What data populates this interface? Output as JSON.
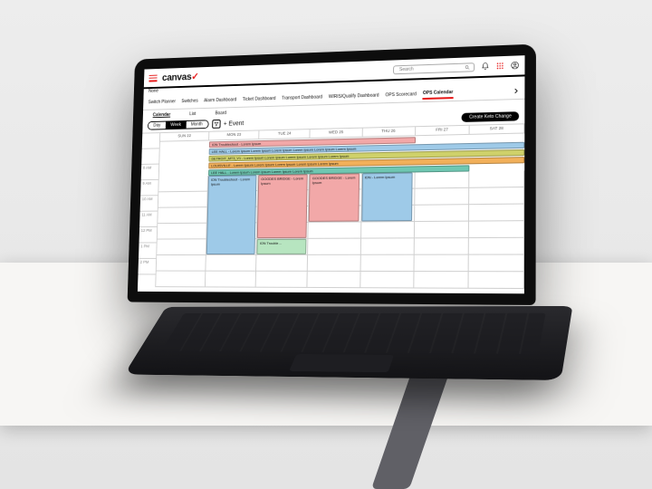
{
  "brand": {
    "name": "canvas",
    "accent": "✓",
    "subtitle": "None"
  },
  "search": {
    "placeholder": "Search"
  },
  "nav_tabs": [
    "Switch Planner",
    "Switches",
    "Alarm Dashboard",
    "Ticket Dashboard",
    "Transport Dashboard",
    "WIRIS/Qualify Dashboard",
    "OPS Scorecard",
    "OPS Calendar"
  ],
  "nav_active": "OPS Calendar",
  "view_tabs": [
    "Calendar",
    "List",
    "Board"
  ],
  "view_active": "Calendar",
  "range": {
    "options": [
      "Day",
      "Week",
      "Month"
    ],
    "active": "Week"
  },
  "add_event_label": "+  Event",
  "cta_label": "Create Keto Change",
  "days": [
    "SUN 22",
    "MON 23",
    "TUE 24",
    "WED 25",
    "THU 26",
    "FRI 27",
    "SAT 28"
  ],
  "hours": [
    "",
    "",
    "8 AM",
    "9 AM",
    "10 AM",
    "11 AM",
    "12 PM",
    "1 PM",
    "2 PM"
  ],
  "allday_events": [
    {
      "color": "#f2a8a8",
      "label": "ION Troubleshoot - Lorem Ipsum",
      "start": 1,
      "span": 4
    },
    {
      "color": "#9ecae8",
      "label": "LEE HALL - Lorem Ipsum Lorem Ipsum Lorem Ipsum Lorem Ipsum Lorem Ipsum Lorem Ipsum",
      "start": 1,
      "span": 6
    },
    {
      "color": "#cfd16a",
      "label": "DETROIT_MT3_V1 - Lorem Ipsum Lorem Ipsum Lorem Ipsum Lorem Ipsum Lorem Ipsum",
      "start": 1,
      "span": 6
    },
    {
      "color": "#f2b05a",
      "label": "LOUISVILLE - Lorem Ipsum Lorem Ipsum Lorem Ipsum Lorem Ipsum Lorem Ipsum",
      "start": 1,
      "span": 6
    },
    {
      "color": "#6fc7b2",
      "label": "LEE HALL - Lorem Ipsum Lorem Ipsum Lorem Ipsum Lorem Ipsum",
      "start": 1,
      "span": 5
    }
  ],
  "timed_events": [
    {
      "color": "#9ecae8",
      "label": "ION Troubleshoot - Lorem Ipsum",
      "day": 1,
      "row": 0,
      "rows": 5,
      "w": 1
    },
    {
      "color": "#f2a8a8",
      "label": "GOODES BRIDGE - Lorem Ipsum",
      "day": 2,
      "row": 0,
      "rows": 4,
      "w": 1
    },
    {
      "color": "#f2a8a8",
      "label": "GOODES BRIDGE - Lorem Ipsum",
      "day": 3,
      "row": 0,
      "rows": 3,
      "w": 1
    },
    {
      "color": "#9ecae8",
      "label": "ION - Lorem Ipsum",
      "day": 4,
      "row": 0,
      "rows": 3,
      "w": 1
    },
    {
      "color": "#b7e5c0",
      "label": "ION Trouble…",
      "day": 2,
      "row": 4,
      "rows": 1,
      "w": 1
    }
  ]
}
